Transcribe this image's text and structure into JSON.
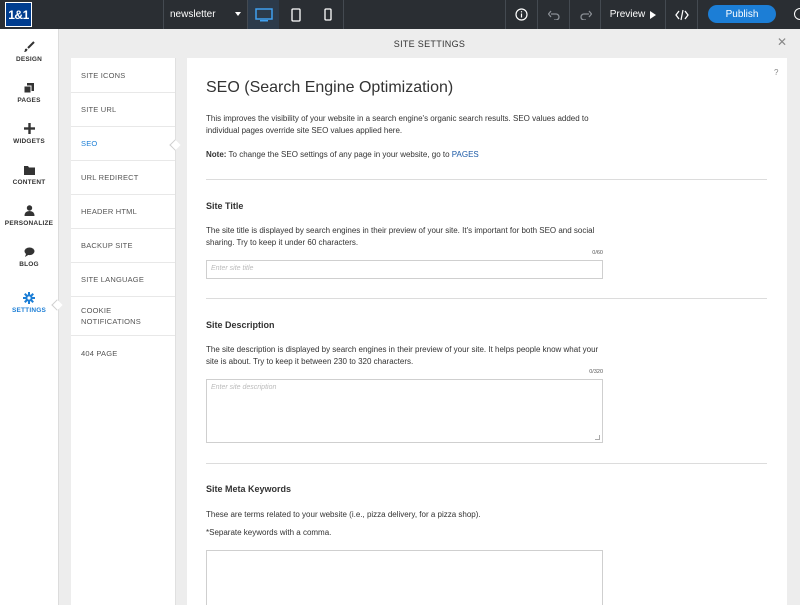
{
  "topbar": {
    "logo": "1&1",
    "site_name": "newsletter",
    "preview_label": "Preview",
    "publish_label": "Publish"
  },
  "rail": {
    "items": [
      {
        "label": "DESIGN",
        "icon": "brush-icon"
      },
      {
        "label": "PAGES",
        "icon": "pages-icon"
      },
      {
        "label": "WIDGETS",
        "icon": "plus-icon"
      },
      {
        "label": "CONTENT",
        "icon": "folder-icon"
      },
      {
        "label": "PERSONALIZE",
        "icon": "person-icon"
      },
      {
        "label": "BLOG",
        "icon": "chat-bubble-icon"
      },
      {
        "label": "SETTINGS",
        "icon": "gear-icon"
      }
    ],
    "active": "SETTINGS"
  },
  "settings": {
    "title": "SITE SETTINGS",
    "nav": [
      "SITE ICONS",
      "SITE URL",
      "SEO",
      "URL REDIRECT",
      "HEADER HTML",
      "BACKUP SITE",
      "SITE LANGUAGE",
      "COOKIE NOTIFICATIONS",
      "404 PAGE"
    ],
    "active": "SEO"
  },
  "seo": {
    "title": "SEO (Search Engine Optimization)",
    "intro": "This improves the visibility of your website in a search engine's organic search results. SEO values added to individual pages override site SEO values applied here.",
    "note_label": "Note:",
    "note_text": " To change the SEO settings of any page in your website, go to ",
    "note_link": "PAGES",
    "site_title": {
      "heading": "Site Title",
      "description": "The site title is displayed by search engines in their preview of your site. It's important for both SEO and social sharing. Try to keep it under 60 characters.",
      "counter": "0/60",
      "placeholder": "Enter site title"
    },
    "site_description": {
      "heading": "Site Description",
      "description": "The site description is displayed by search engines in their preview of your site. It helps people know what your site is about. Try to keep it between 230 to 320 characters.",
      "counter": "0/320",
      "placeholder": "Enter site description"
    },
    "meta_keywords": {
      "heading": "Site Meta Keywords",
      "description": "These are terms related to your website (i.e., pizza delivery, for a pizza shop).",
      "hint": "*Separate keywords with a comma."
    }
  }
}
